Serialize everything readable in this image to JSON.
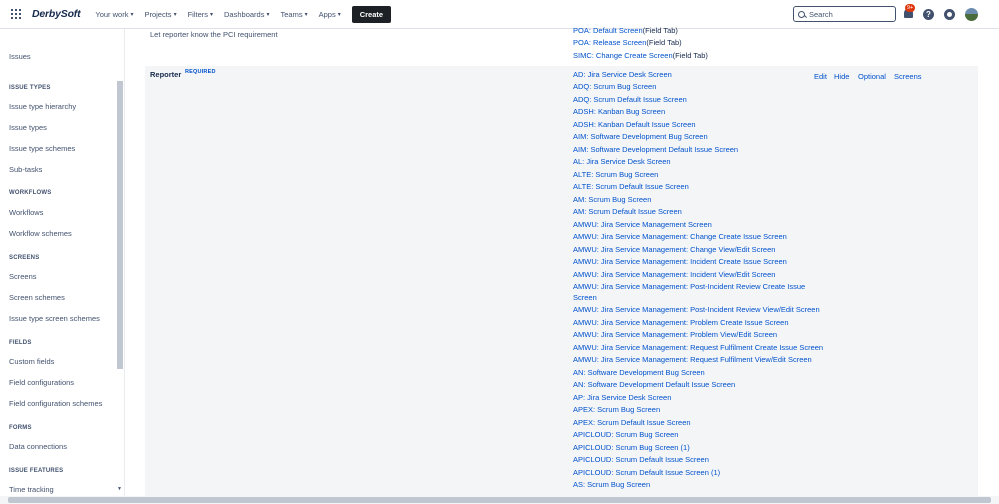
{
  "topbar": {
    "logo": "DerbySoft",
    "nav": [
      "Your work",
      "Projects",
      "Filters",
      "Dashboards",
      "Teams",
      "Apps"
    ],
    "create_label": "Create",
    "search_placeholder": "Search",
    "notification_count": "9+"
  },
  "sidebar": {
    "issues_label": "Issues",
    "sections": [
      {
        "title": "ISSUE TYPES",
        "items": [
          "Issue type hierarchy",
          "Issue types",
          "Issue type schemes",
          "Sub-tasks"
        ]
      },
      {
        "title": "WORKFLOWS",
        "items": [
          "Workflows",
          "Workflow schemes"
        ]
      },
      {
        "title": "SCREENS",
        "items": [
          "Screens",
          "Screen schemes",
          "Issue type screen schemes"
        ]
      },
      {
        "title": "FIELDS",
        "items": [
          "Custom fields",
          "Field configurations",
          "Field configuration schemes"
        ]
      },
      {
        "title": "FORMS",
        "items": [
          "Data connections"
        ]
      },
      {
        "title": "ISSUE FEATURES",
        "items": [
          "Time tracking"
        ]
      }
    ]
  },
  "main": {
    "top_links": [
      {
        "text": "POA: Default Screen",
        "tail": "(Field Tab)"
      },
      {
        "text": "POA: Release Screen",
        "tail": "(Field Tab)"
      },
      {
        "text": "SIMC: Change Create Screen",
        "tail": "(Field Tab)"
      }
    ],
    "description": "Let reporter know the PCI requirement",
    "field_name": "Reporter",
    "required_label": "REQUIRED",
    "actions": [
      "Edit",
      "Hide",
      "Optional",
      "Screens"
    ],
    "screens": [
      "AD: Jira Service Desk Screen",
      "ADQ: Scrum Bug Screen",
      "ADQ: Scrum Default Issue Screen",
      "ADSH: Kanban Bug Screen",
      "ADSH: Kanban Default Issue Screen",
      "AIM: Software Development Bug Screen",
      "AIM: Software Development Default Issue Screen",
      "AL: Jira Service Desk Screen",
      "ALTE: Scrum Bug Screen",
      "ALTE: Scrum Default Issue Screen",
      "AM: Scrum Bug Screen",
      "AM: Scrum Default Issue Screen",
      "AMWU: Jira Service Management Screen",
      "AMWU: Jira Service Management: Change Create Issue Screen",
      "AMWU: Jira Service Management: Change View/Edit Screen",
      "AMWU: Jira Service Management: Incident Create Issue Screen",
      "AMWU: Jira Service Management: Incident View/Edit Screen",
      "AMWU: Jira Service Management: Post-Incident Review Create Issue",
      "Screen",
      "AMWU: Jira Service Management: Post-Incident Review View/Edit Screen",
      "AMWU: Jira Service Management: Problem Create Issue Screen",
      "AMWU: Jira Service Management: Problem View/Edit Screen",
      "AMWU: Jira Service Management: Request Fulfilment Create Issue Screen",
      "AMWU: Jira Service Management: Request Fulfilment View/Edit Screen",
      "AN: Software Development Bug Screen",
      "AN: Software Development Default Issue Screen",
      "AP: Jira Service Desk Screen",
      "APEX: Scrum Bug Screen",
      "APEX: Scrum Default Issue Screen",
      "APICLOUD: Scrum Bug Screen",
      "APICLOUD: Scrum Bug Screen (1)",
      "APICLOUD: Scrum Default Issue Screen",
      "APICLOUD: Scrum Default Issue Screen (1)",
      "AS: Scrum Bug Screen"
    ]
  }
}
